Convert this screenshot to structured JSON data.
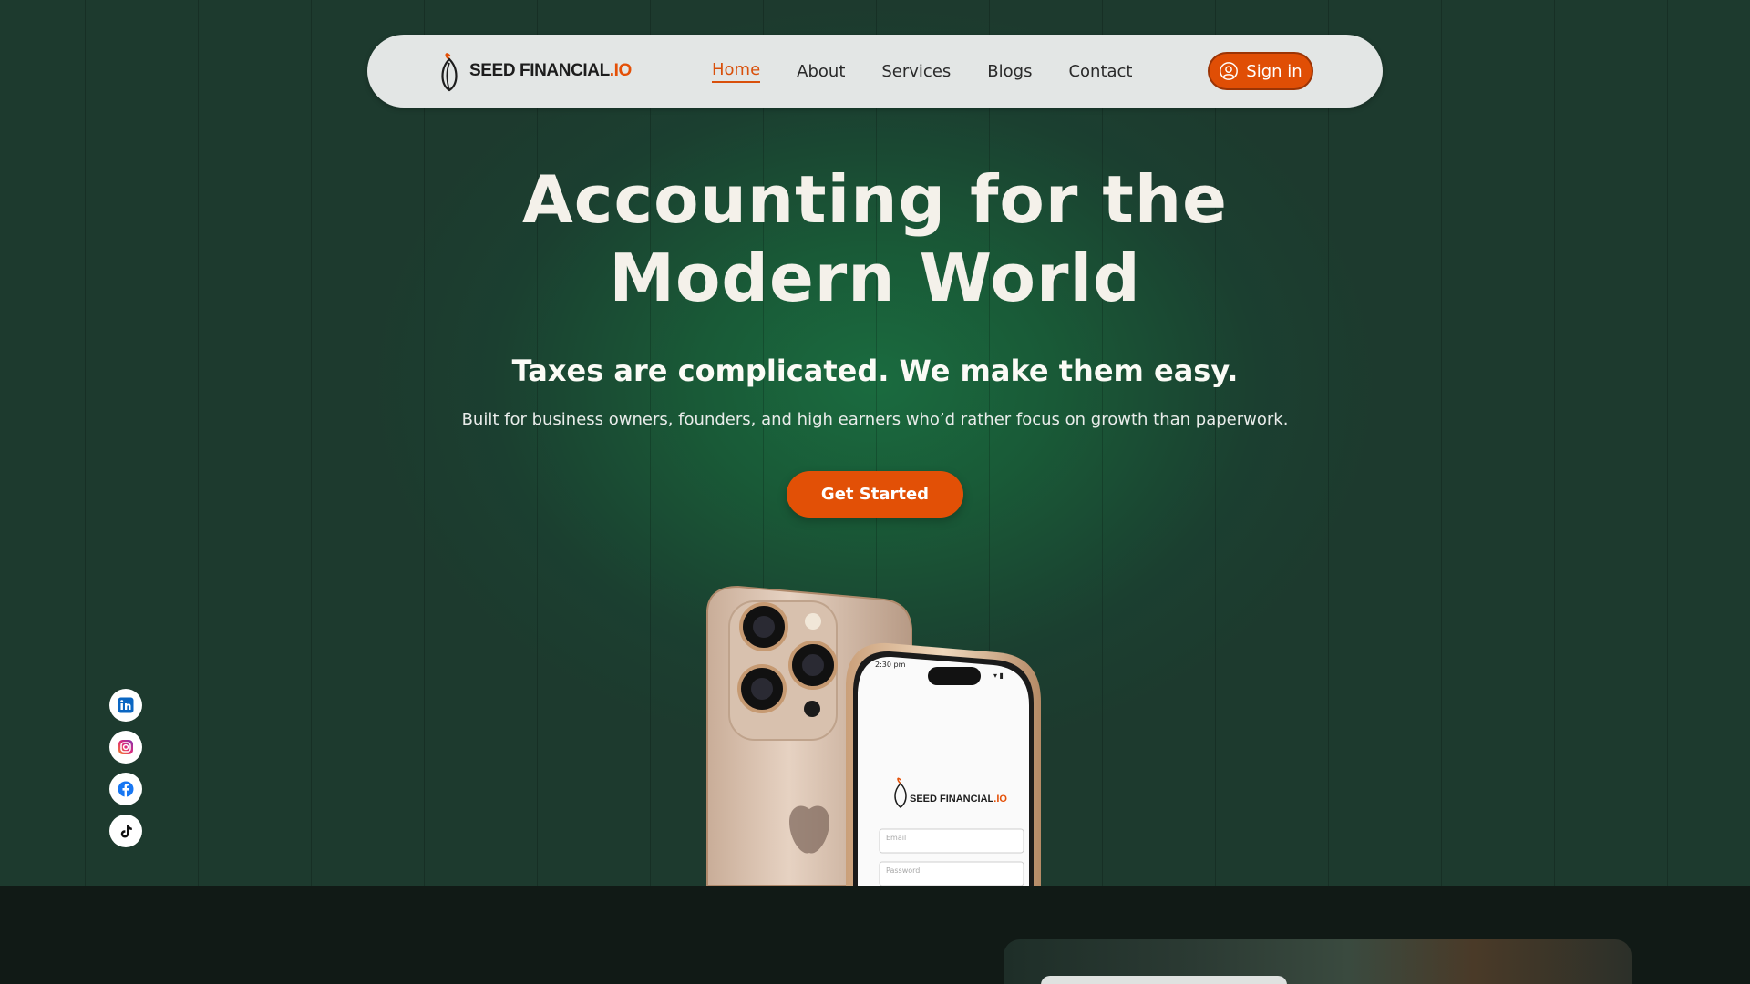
{
  "brand": {
    "name_primary": "SEED FINANCIAL",
    "name_accent": ".IO",
    "accent_color": "#e45007"
  },
  "nav": {
    "items": [
      {
        "label": "Home",
        "active": true
      },
      {
        "label": "About",
        "active": false
      },
      {
        "label": "Services",
        "active": false
      },
      {
        "label": "Blogs",
        "active": false
      },
      {
        "label": "Contact",
        "active": false
      }
    ],
    "signin_label": "Sign in",
    "signin_icon": "user-circle-icon"
  },
  "hero": {
    "title_line1": "Accounting for the",
    "title_line2": "Modern World",
    "subtitle": "Taxes are complicated. We make them easy.",
    "tagline": "Built for business owners, founders, and high earners who’d rather focus on growth than paperwork.",
    "cta_label": "Get Started",
    "cta_color": "#e25006"
  },
  "phone_screen": {
    "time": "2:30 pm",
    "brand_primary": "SEED FINANCIAL",
    "brand_accent": ".IO",
    "email_placeholder": "Email",
    "password_placeholder": "Password"
  },
  "social": [
    {
      "name": "linkedin-icon",
      "color": "#0a66c2"
    },
    {
      "name": "instagram-icon",
      "color": "#d6249f"
    },
    {
      "name": "facebook-icon",
      "color": "#1877f2"
    },
    {
      "name": "tiktok-icon",
      "color": "#000000"
    }
  ]
}
